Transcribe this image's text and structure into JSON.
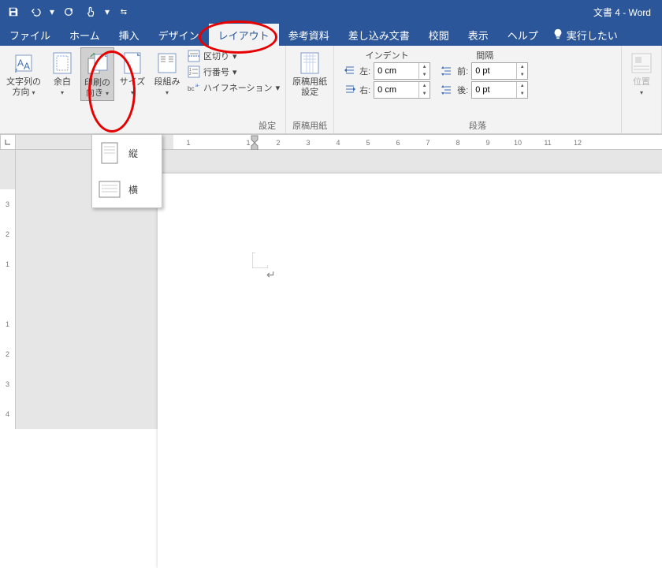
{
  "window": {
    "title": "文書 4 - Word"
  },
  "tabs": {
    "file": "ファイル",
    "home": "ホーム",
    "insert": "挿入",
    "design": "デザイン",
    "layout": "レイアウト",
    "references": "参考資料",
    "mailings": "差し込み文書",
    "review": "校閲",
    "view": "表示",
    "help": "ヘルプ",
    "tell_me": "実行したい"
  },
  "ribbon": {
    "text_direction": {
      "l1": "文字列の",
      "l2": "方向"
    },
    "margins": "余白",
    "orientation": {
      "l1": "印刷の",
      "l2": "向き"
    },
    "size": "サイズ",
    "columns": "段組み",
    "breaks": "区切り",
    "line_numbers": "行番号",
    "hyphenation": "ハイフネーション",
    "page_setup_group": "設定",
    "manuscript": {
      "l1": "原稿用紙",
      "l2": "設定",
      "group": "原稿用紙"
    },
    "indent": {
      "heading": "インデント",
      "left": "左:",
      "right": "右:",
      "left_val": "0 cm",
      "right_val": "0 cm"
    },
    "spacing": {
      "heading": "間隔",
      "before": "前:",
      "after": "後:",
      "before_val": "0 pt",
      "after_val": "0 pt"
    },
    "paragraph_group": "段落",
    "position": "位置"
  },
  "orientation_menu": {
    "portrait": "縦",
    "landscape": "横"
  },
  "ruler_h": [
    "1",
    "",
    "1",
    "2",
    "3",
    "4",
    "5",
    "6",
    "7",
    "8",
    "9",
    "10",
    "11",
    "12"
  ],
  "ruler_v": [
    "3",
    "2",
    "1",
    "",
    "1",
    "2",
    "3",
    "4"
  ]
}
